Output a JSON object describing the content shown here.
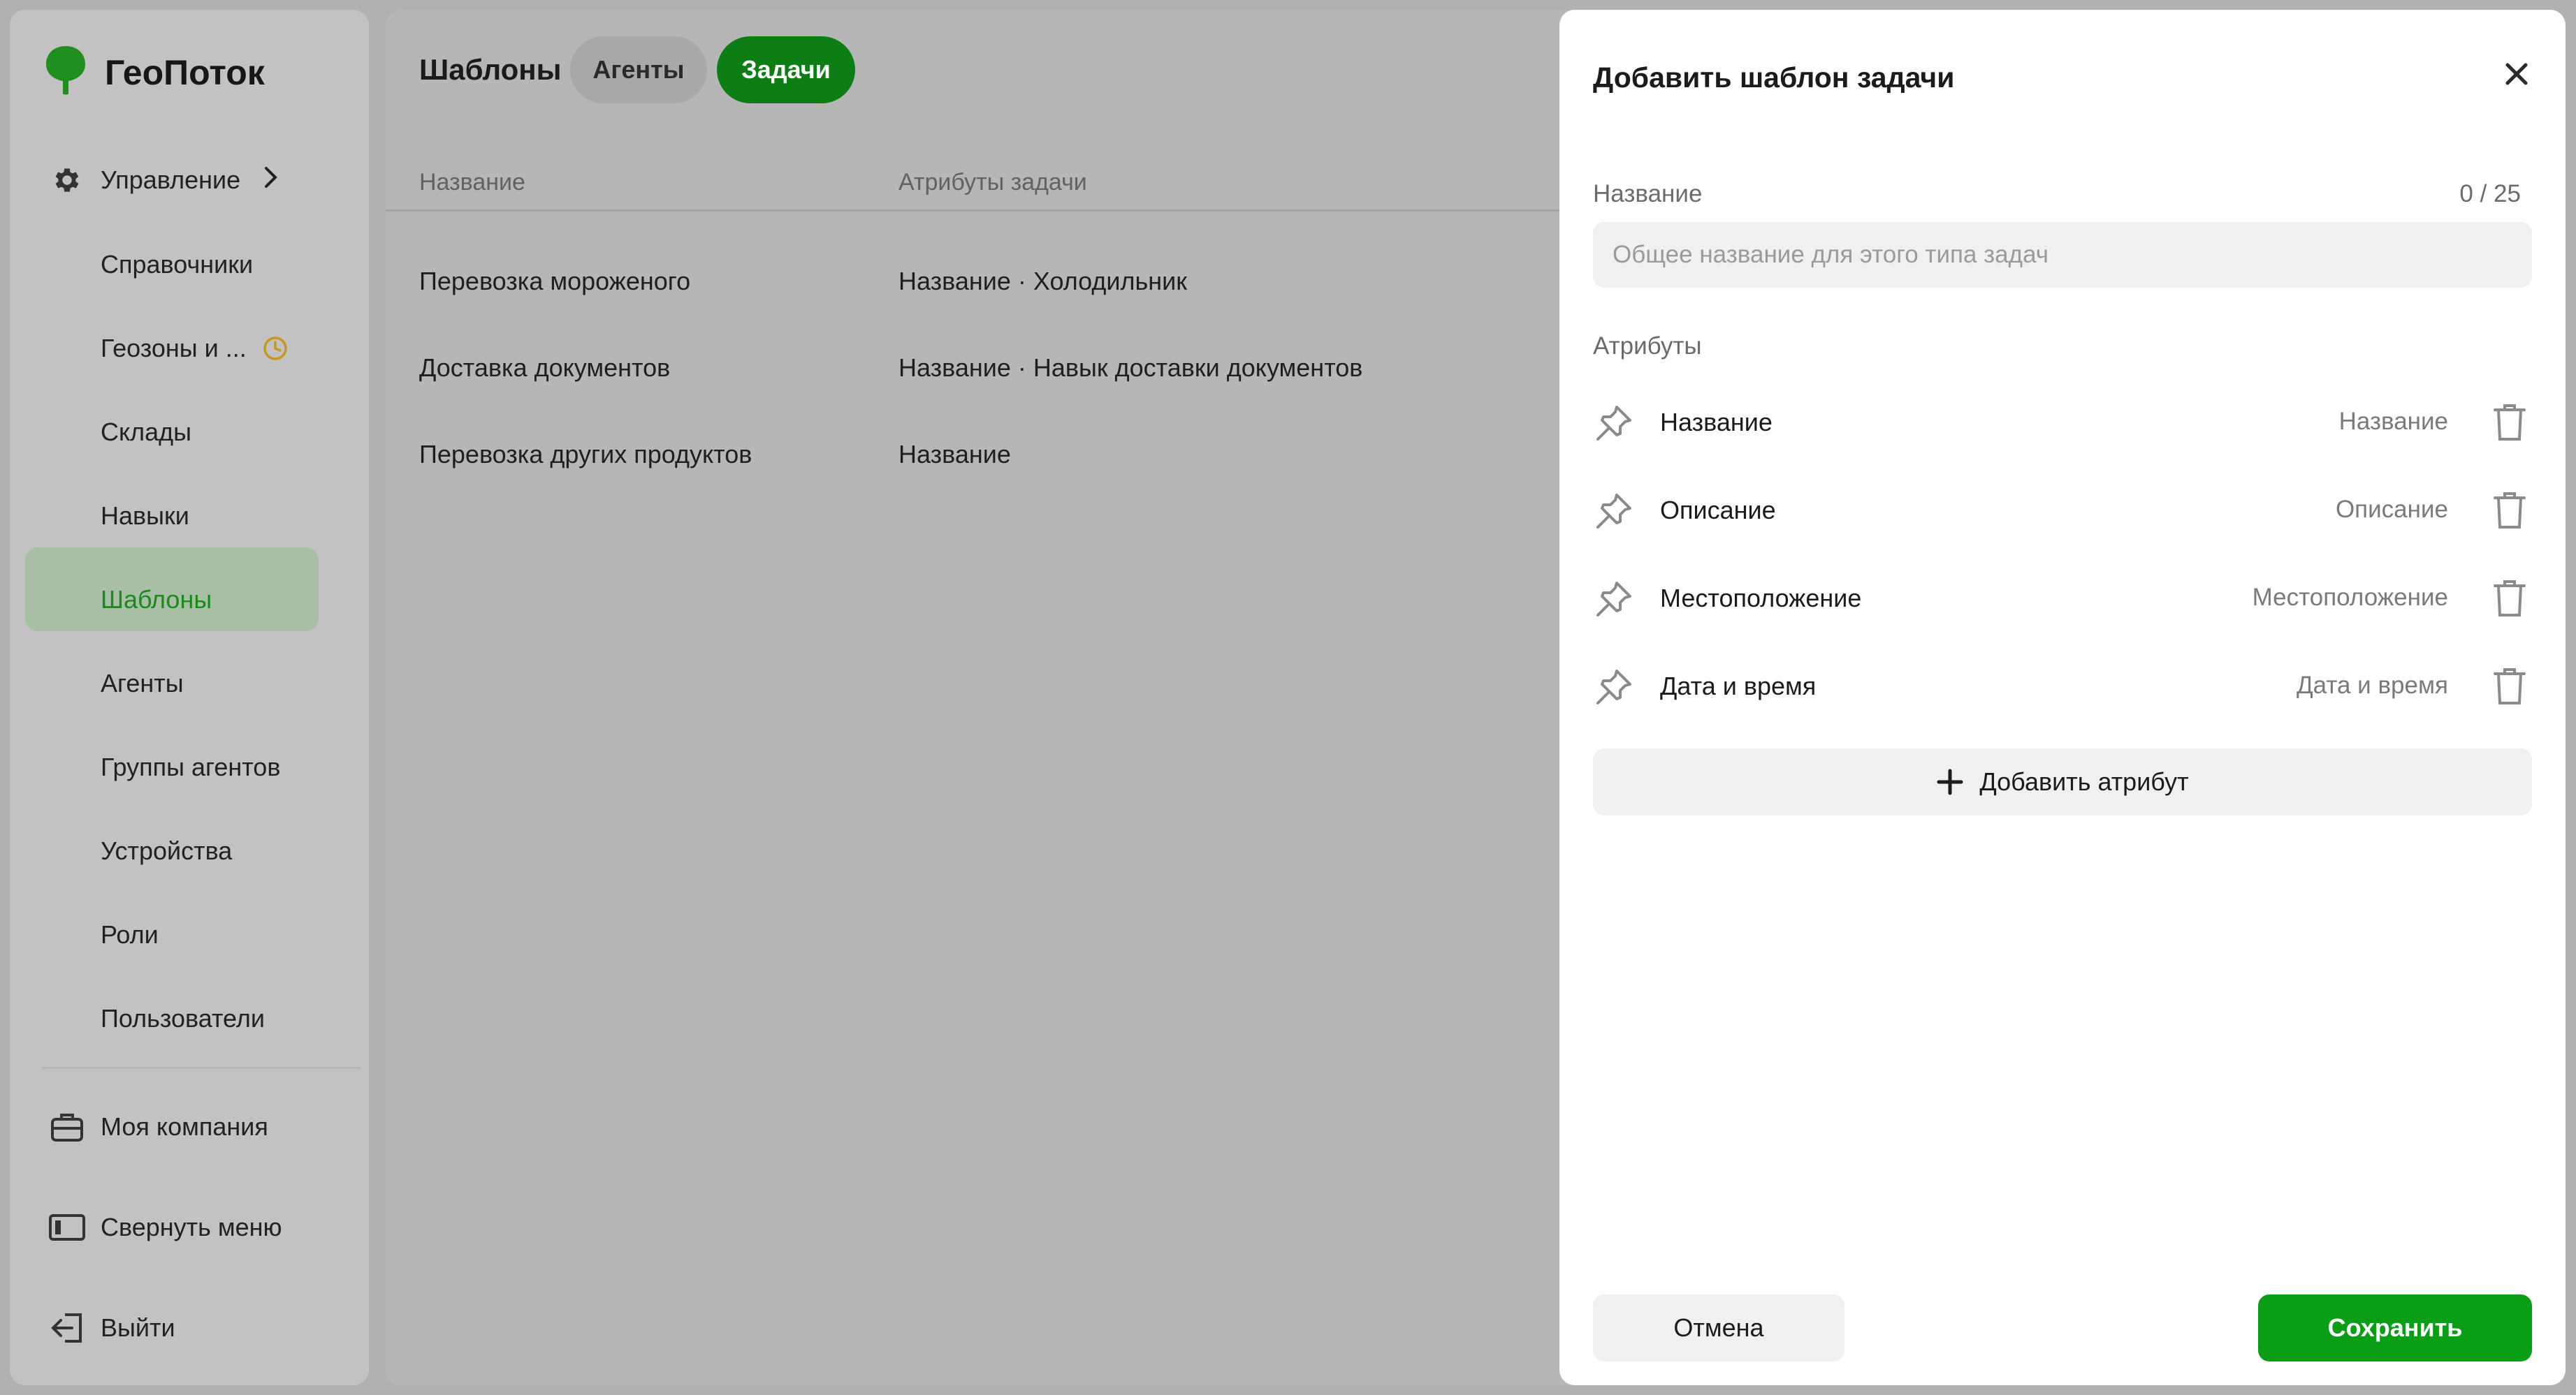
{
  "app": {
    "name": "ГеоПоток"
  },
  "sidebar": {
    "management_label": "Управление",
    "items": [
      {
        "label": "Справочники"
      },
      {
        "label": "Геозоны и ..."
      },
      {
        "label": "Склады"
      },
      {
        "label": "Навыки"
      },
      {
        "label": "Шаблоны"
      },
      {
        "label": "Агенты"
      },
      {
        "label": "Группы агентов"
      },
      {
        "label": "Устройства"
      },
      {
        "label": "Роли"
      },
      {
        "label": "Пользователи"
      }
    ],
    "bottom": {
      "company": "Моя компания",
      "collapse": "Свернуть меню",
      "logout": "Выйти"
    }
  },
  "main": {
    "title": "Шаблоны",
    "tabs": [
      {
        "label": "Агенты",
        "active": false
      },
      {
        "label": "Задачи",
        "active": true
      }
    ],
    "columns": [
      "Название",
      "Атрибуты задачи"
    ],
    "rows": [
      {
        "name": "Перевозка мороженого",
        "attrs": "Название · Холодильник"
      },
      {
        "name": "Доставка документов",
        "attrs": "Название · Навык доставки документов"
      },
      {
        "name": "Перевозка других продуктов",
        "attrs": "Название"
      }
    ]
  },
  "modal": {
    "title": "Добавить шаблон задачи",
    "name_label": "Название",
    "name_counter": "0 / 25",
    "name_value": "",
    "name_placeholder": "Общее название для этого типа задач",
    "attributes_label": "Атрибуты",
    "attributes": [
      {
        "name": "Название",
        "type": "Название"
      },
      {
        "name": "Описание",
        "type": "Описание"
      },
      {
        "name": "Местоположение",
        "type": "Местоположение"
      },
      {
        "name": "Дата и время",
        "type": "Дата и время"
      }
    ],
    "add_attribute_label": "Добавить атрибут",
    "cancel_label": "Отмена",
    "save_label": "Сохранить"
  },
  "colors": {
    "accent": "#0a9e16",
    "overlay_bg": "#b1b1b1",
    "active_nav_bg": "#a9bfa5",
    "warning_icon": "#c8961a"
  },
  "icons": {
    "logo": "leaf-pin-icon",
    "management": "gear-icon",
    "geozones_status": "clock-icon",
    "company": "briefcase-icon",
    "collapse": "sidebar-collapse-icon",
    "logout": "logout-icon",
    "close": "close-icon",
    "drag": "pin-icon",
    "delete": "trash-icon",
    "add": "plus-icon"
  }
}
